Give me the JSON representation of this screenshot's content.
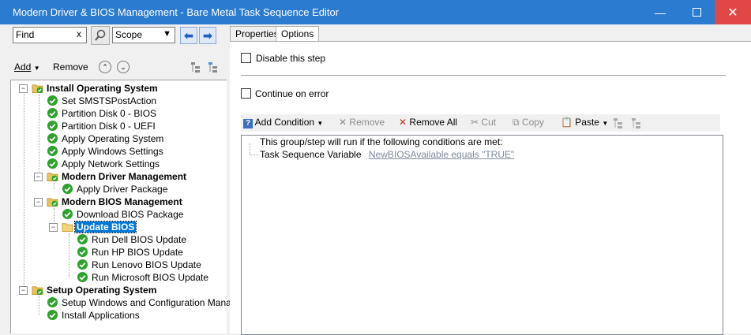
{
  "window": {
    "title": "Modern Driver & BIOS Management - Bare Metal Task Sequence Editor",
    "min_icon": "minimize-icon",
    "max_icon": "maximize-icon",
    "close_icon": "close-icon"
  },
  "search": {
    "value": "Find",
    "clear": "x",
    "scope": "Scope"
  },
  "left_toolbar": {
    "add": "Add",
    "remove": "Remove"
  },
  "tree": [
    {
      "label": "Install Operating System",
      "type": "group",
      "bold": true
    },
    {
      "label": "Set SMSTSPostAction",
      "type": "step"
    },
    {
      "label": "Partition Disk 0 - BIOS",
      "type": "step"
    },
    {
      "label": "Partition Disk 0 - UEFI",
      "type": "step"
    },
    {
      "label": "Apply Operating System",
      "type": "step"
    },
    {
      "label": "Apply Windows Settings",
      "type": "step"
    },
    {
      "label": "Apply Network Settings",
      "type": "step"
    },
    {
      "label": "Modern Driver Management",
      "type": "group",
      "bold": true
    },
    {
      "label": "Apply Driver Package",
      "type": "step"
    },
    {
      "label": "Modern BIOS Management",
      "type": "group",
      "bold": true
    },
    {
      "label": "Download BIOS Package",
      "type": "step"
    },
    {
      "label": "Update BIOS",
      "type": "group",
      "bold": true,
      "selected": true
    },
    {
      "label": "Run Dell BIOS Update",
      "type": "step"
    },
    {
      "label": "Run HP BIOS Update",
      "type": "step"
    },
    {
      "label": "Run Lenovo BIOS Update",
      "type": "step"
    },
    {
      "label": "Run Microsoft BIOS Update",
      "type": "step"
    },
    {
      "label": "Setup Operating System",
      "type": "group",
      "bold": true
    },
    {
      "label": "Setup Windows and Configuration Manager",
      "type": "step"
    },
    {
      "label": "Install Applications",
      "type": "step"
    }
  ],
  "tabs": {
    "properties": "Properties",
    "options": "Options"
  },
  "options": {
    "disable_step": "Disable this step",
    "continue_on_error": "Continue on error"
  },
  "cond_toolbar": {
    "add_condition": "Add Condition",
    "remove": "Remove",
    "remove_all": "Remove All",
    "cut": "Cut",
    "copy": "Copy",
    "paste": "Paste"
  },
  "conditions": {
    "header": "This group/step will run if the following conditions are met:",
    "item_label": "Task Sequence Variable",
    "item_value": "NewBIOSAvailable equals \"TRUE\""
  },
  "colors": {
    "titlebar": "#2b7bd0",
    "close": "#e04848",
    "step_ok": "#2ea12e",
    "folder": "#e8c35a",
    "selection": "#0078d7"
  }
}
